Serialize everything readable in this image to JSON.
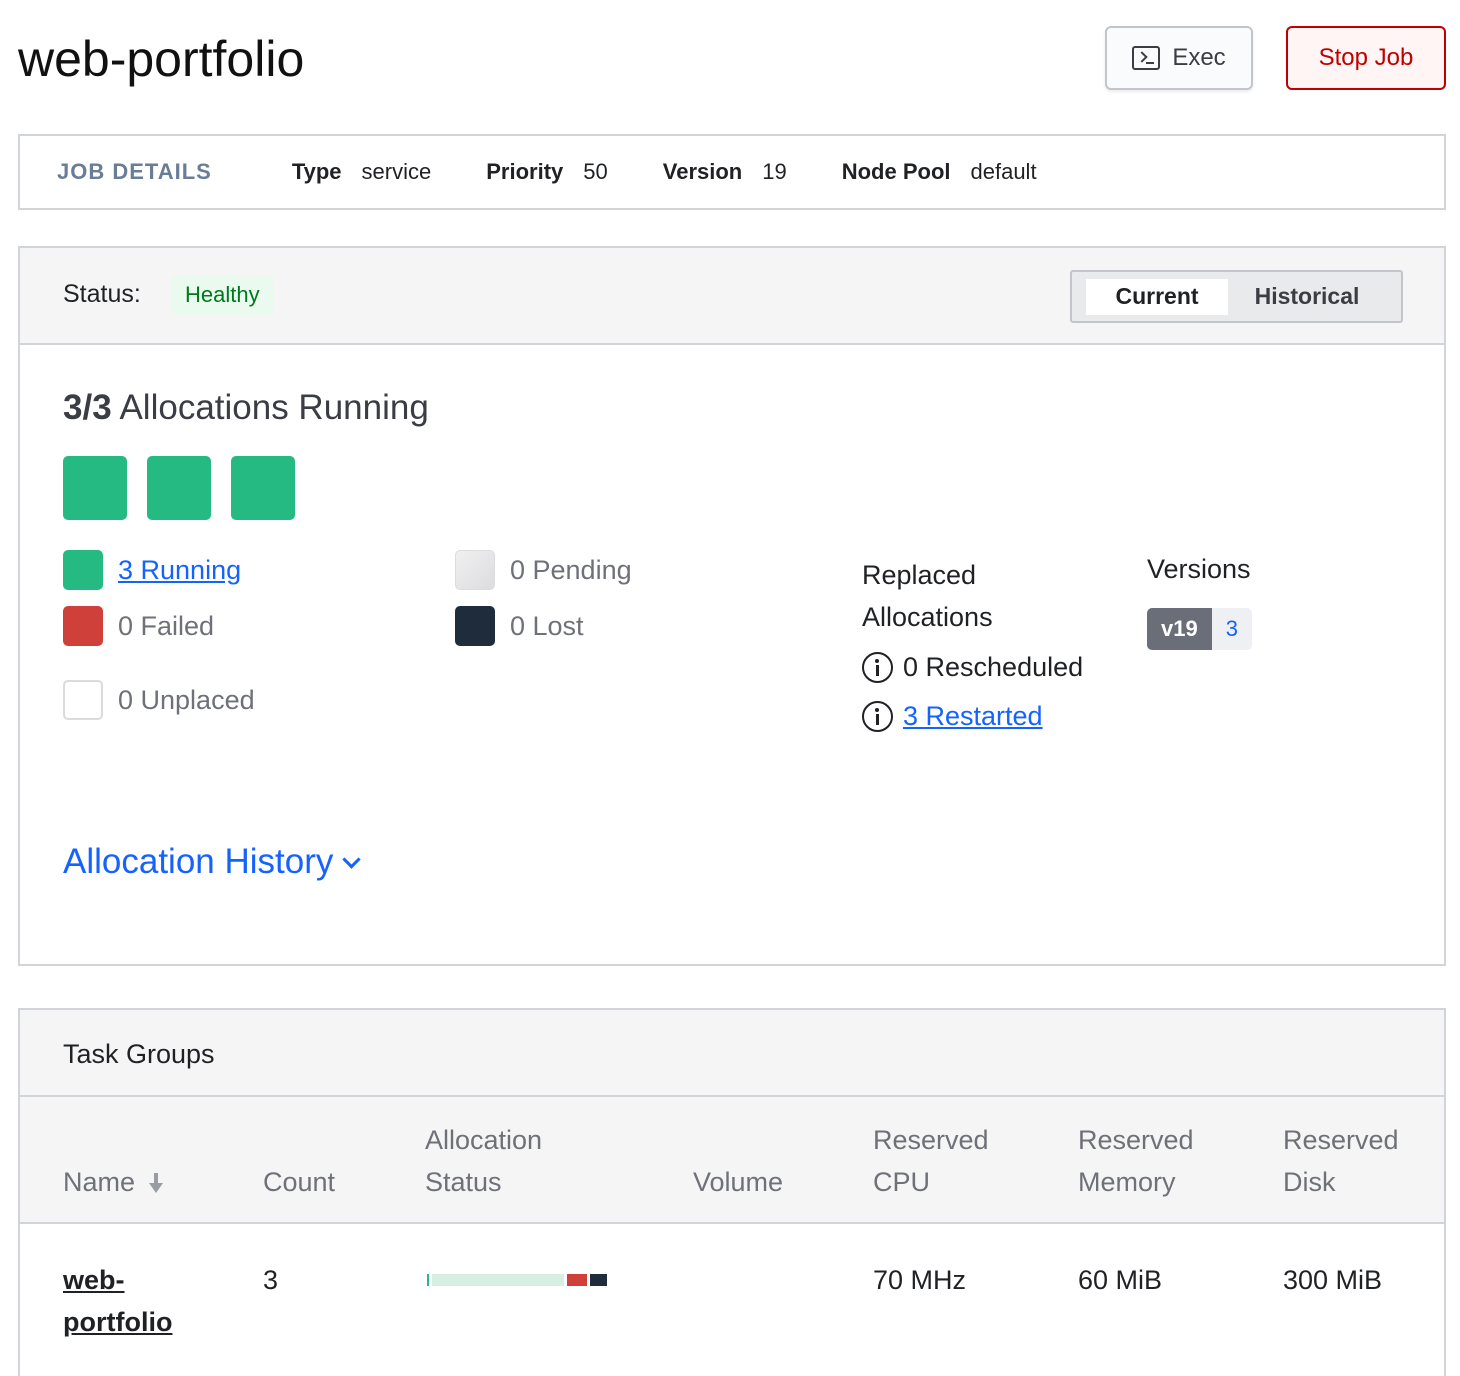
{
  "title": "web-portfolio",
  "actions": {
    "exec_label": "Exec",
    "stop_label": "Stop Job"
  },
  "job_details": {
    "label": "JOB DETAILS",
    "items": [
      {
        "key": "Type",
        "value": "service"
      },
      {
        "key": "Priority",
        "value": "50"
      },
      {
        "key": "Version",
        "value": "19"
      },
      {
        "key": "Node Pool",
        "value": "default"
      }
    ]
  },
  "summary": {
    "status_label": "Status:",
    "status_value": "Healthy",
    "toggle": {
      "current": "Current",
      "historical": "Historical"
    },
    "alloc_count": "3/3",
    "alloc_text": "Allocations Running",
    "legend": {
      "running": "3 Running",
      "failed": "0 Failed",
      "unplaced": "0 Unplaced",
      "pending": "0 Pending",
      "lost": "0 Lost"
    },
    "replaced": {
      "title": "Replaced Allocations",
      "rescheduled": "0 Rescheduled",
      "restarted": "3 Restarted"
    },
    "versions": {
      "title": "Versions",
      "tag": "v19",
      "count": "3"
    },
    "history_link": "Allocation History"
  },
  "task_groups": {
    "title": "Task Groups",
    "columns": {
      "name": "Name",
      "count": "Count",
      "alloc_status": "Allocation Status",
      "volume": "Volume",
      "cpu": "Reserved CPU",
      "memory": "Reserved Memory",
      "disk": "Reserved Disk"
    },
    "rows": [
      {
        "name": "web-portfolio",
        "count": "3",
        "volume": "",
        "cpu": "70 MHz",
        "memory": "60 MiB",
        "disk": "300 MiB",
        "alloc_status_colors": {
          "queued": "#d7efe2",
          "failed": "#d0403a",
          "lost": "#1f2c3c"
        }
      }
    ]
  },
  "colors": {
    "running": "#25ba81",
    "failed": "#d0403a",
    "lost": "#1f2c3c",
    "link": "#1563ff",
    "danger": "#c00000",
    "healthy": "#00781e"
  }
}
